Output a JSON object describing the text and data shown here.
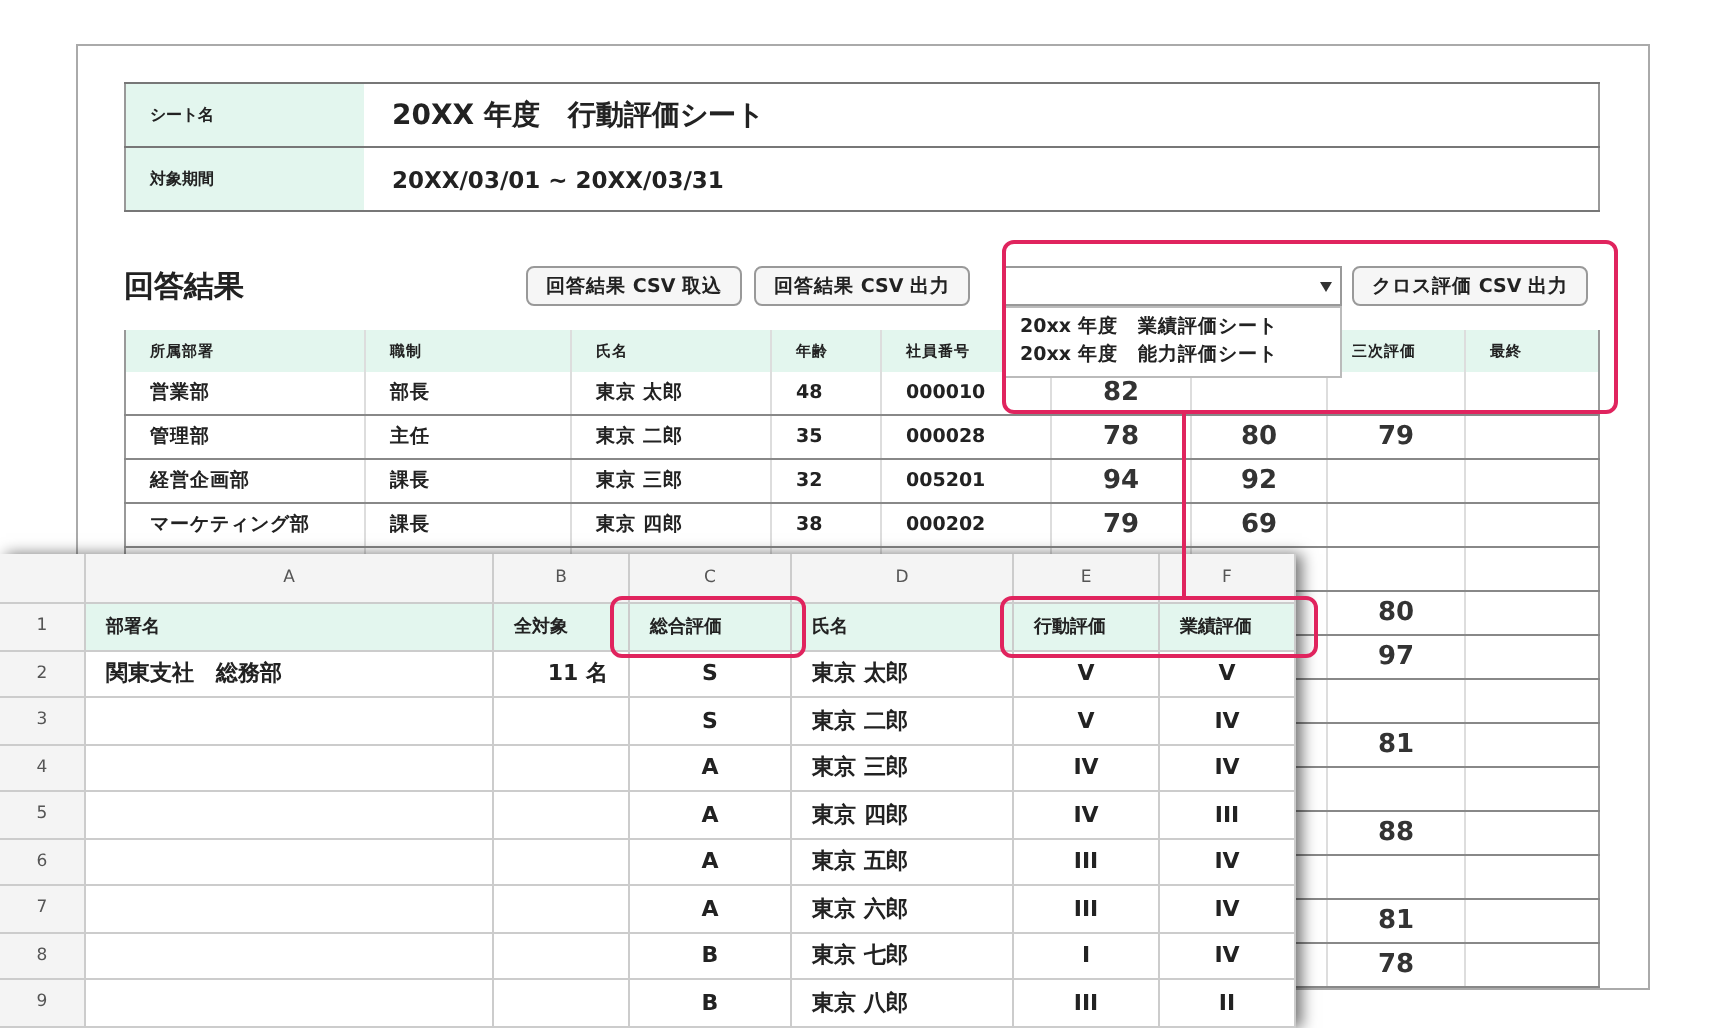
{
  "info": [
    {
      "label": "シート名",
      "value": "20XX 年度　行動評価シート",
      "kind": "title"
    },
    {
      "label": "対象期間",
      "value": "20XX/03/01 ~ 20XX/03/31",
      "kind": "plain"
    }
  ],
  "section_title": "回答結果",
  "buttons": [
    "回答結果 CSV 取込",
    "回答結果 CSV 出力"
  ],
  "cross": {
    "select_options": [
      "20xx 年度　業績評価シート",
      "20xx 年度　能力評価シート"
    ],
    "button": "クロス評価 CSV 出力"
  },
  "table": {
    "columns": [
      "所属部署",
      "職制",
      "氏名",
      "年齢",
      "社員番号",
      "",
      "",
      "三次評価",
      "最終"
    ],
    "rows": [
      {
        "cells": [
          "営業部",
          "部長",
          "東京 太郎",
          "48",
          "000010",
          "82"
        ]
      },
      {
        "cells": [
          "管理部",
          "主任",
          "東京 二郎",
          "35",
          "000028",
          "78",
          "80",
          "79"
        ]
      },
      {
        "cells": [
          "経営企画部",
          "課長",
          "東京 三郎",
          "32",
          "005201",
          "94",
          "92"
        ]
      },
      {
        "cells": [
          "マーケティング部",
          "課長",
          "東京 四郎",
          "38",
          "000202",
          "79",
          "69"
        ]
      },
      {
        "third_eval": null
      },
      {
        "third_eval": "80"
      },
      {
        "third_eval": "97"
      },
      {
        "third_eval": null
      },
      {
        "third_eval": "81"
      },
      {
        "third_eval": null
      },
      {
        "third_eval": "88"
      },
      {
        "third_eval": null
      },
      {
        "third_eval": "81"
      },
      {
        "third_eval": "78"
      }
    ]
  },
  "spreadsheet": {
    "columns": [
      "A",
      "B",
      "C",
      "D",
      "E",
      "F"
    ],
    "rows": [
      {
        "number": "1",
        "kind": "header",
        "a": "部署名",
        "b": "全対象",
        "c": "総合評価",
        "d": "氏名",
        "e": "行動評価",
        "f": "業績評価"
      },
      {
        "number": "2",
        "kind": "data",
        "a": "関東支社　総務部",
        "b": "11 名",
        "c": "S",
        "d": "東京 太郎",
        "e": "V",
        "f": "V"
      },
      {
        "number": "3",
        "kind": "data",
        "c": "S",
        "d": "東京 二郎",
        "e": "V",
        "f": "IV"
      },
      {
        "number": "4",
        "kind": "data",
        "c": "A",
        "d": "東京 三郎",
        "e": "IV",
        "f": "IV"
      },
      {
        "number": "5",
        "kind": "data",
        "c": "A",
        "d": "東京 四郎",
        "e": "IV",
        "f": "III"
      },
      {
        "number": "6",
        "kind": "data",
        "c": "A",
        "d": "東京 五郎",
        "e": "III",
        "f": "IV"
      },
      {
        "number": "7",
        "kind": "data",
        "c": "A",
        "d": "東京 六郎",
        "e": "III",
        "f": "IV"
      },
      {
        "number": "8",
        "kind": "data",
        "c": "B",
        "d": "東京 七郎",
        "e": "I",
        "f": "IV"
      },
      {
        "number": "9",
        "kind": "data",
        "c": "B",
        "d": "東京 八郎",
        "e": "III",
        "f": "II"
      }
    ]
  }
}
